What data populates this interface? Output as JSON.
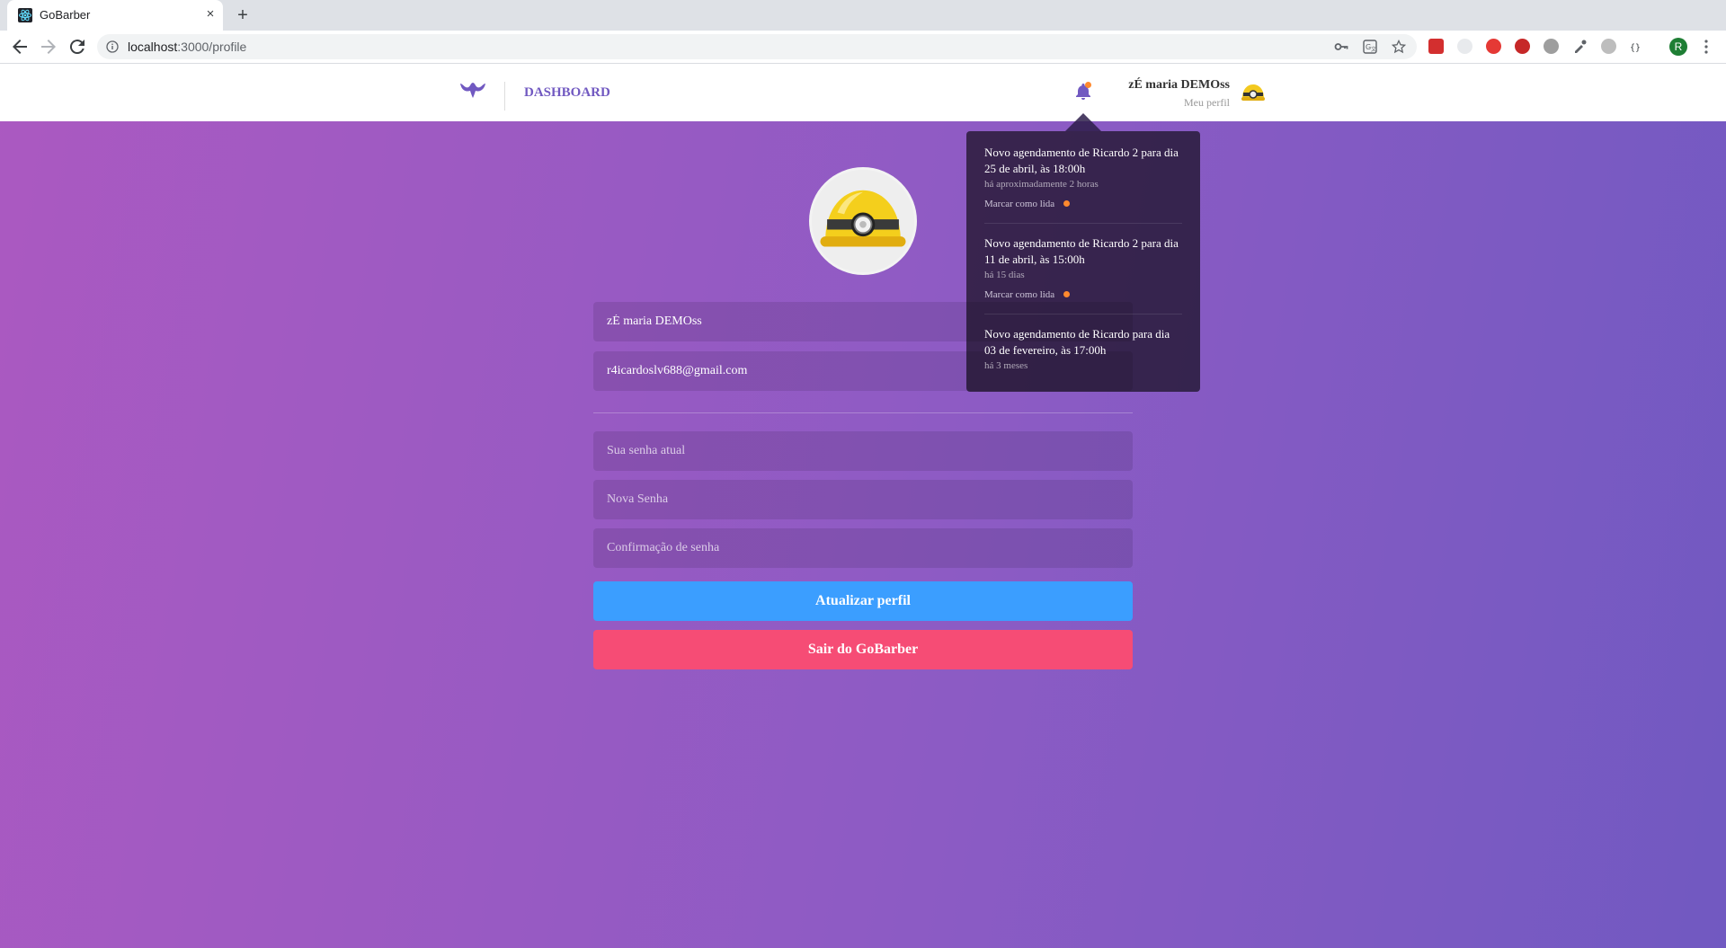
{
  "browser": {
    "tab_title": "GoBarber",
    "tab_close": "×",
    "new_tab": "+",
    "url_host": "localhost",
    "url_path": ":3000/profile",
    "profile_initial": "R"
  },
  "header": {
    "nav_link": "DASHBOARD",
    "user_name": "zÉ maria DEMOss",
    "profile_link": "Meu perfil",
    "bell_has_unread": true
  },
  "profile_form": {
    "name_value": "zÉ maria DEMOss",
    "email_value": "r4icardoslv688@gmail.com",
    "old_password_placeholder": "Sua senha atual",
    "new_password_placeholder": "Nova Senha",
    "confirm_password_placeholder": "Confirmação de senha",
    "update_button": "Atualizar perfil",
    "logout_button": "Sair do GoBarber"
  },
  "notifications": [
    {
      "text": "Novo agendamento de Ricardo 2 para dia 25 de abril, às 18:00h",
      "time": "há aproximadamente 2 horas",
      "action": "Marcar como lida",
      "unread": true
    },
    {
      "text": "Novo agendamento de Ricardo 2 para dia 11 de abril, às 15:00h",
      "time": "há 15 dias",
      "action": "Marcar como lida",
      "unread": true
    },
    {
      "text": "Novo agendamento de Ricardo para dia 03 de fevereiro, às 17:00h",
      "time": "há 3 meses",
      "action": "",
      "unread": false
    }
  ],
  "colors": {
    "brand": "#7159c1",
    "update_button": "#3b9eff",
    "logout_button": "#f64c75",
    "unread_dot": "#ff892e"
  }
}
